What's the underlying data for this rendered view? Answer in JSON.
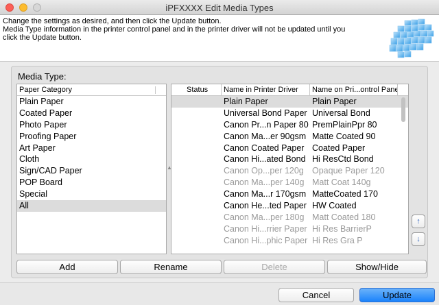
{
  "window": {
    "title": "iPFXXXX Edit Media Types"
  },
  "info": {
    "lines": [
      "Change the settings as desired, and then click the Update button.",
      "Media Type information in the printer control panel and in the printer driver will not be updated until you",
      "click the Update button."
    ],
    "logo_icon": "printer-media-logo-icon"
  },
  "media_type_group": {
    "label": "Media Type:"
  },
  "paper_category": {
    "header": "Paper Category",
    "items": [
      "Plain Paper",
      "Coated Paper",
      "Photo Paper",
      "Proofing Paper",
      "Art Paper",
      "Cloth",
      "Sign/CAD Paper",
      "POP Board",
      "Special",
      "All"
    ],
    "selected": "All"
  },
  "media_table": {
    "headers": [
      "Status",
      "Name in Printer Driver",
      "Name on Pri...ontrol Panel"
    ],
    "rows": [
      {
        "status": "",
        "driver": "Plain Paper",
        "panel": "Plain Paper"
      },
      {
        "status": "",
        "driver": "Universal Bond Paper",
        "panel": "Universal Bond"
      },
      {
        "status": "",
        "driver": "Canon Pr...n Paper 80",
        "panel": "PremPlainPpr 80"
      },
      {
        "status": "",
        "driver": "Canon Ma...er 90gsm",
        "panel": "Matte Coated 90"
      },
      {
        "status": "",
        "driver": "Canon Coated Paper",
        "panel": "Coated Paper"
      },
      {
        "status": "",
        "driver": "Canon Hi...ated Bond",
        "panel": "Hi ResCtd Bond"
      },
      {
        "status": "",
        "driver": "Canon Op...per 120g",
        "panel": "Opaque Paper 120"
      },
      {
        "status": "",
        "driver": "Canon Ma...per 140g",
        "panel": "Matt Coat 140g"
      },
      {
        "status": "",
        "driver": "Canon Ma...r 170gsm",
        "panel": "MatteCoated 170"
      },
      {
        "status": "",
        "driver": "Canon He...ted Paper",
        "panel": "HW Coated"
      },
      {
        "status": "",
        "driver": "Canon Ma...per 180g",
        "panel": "Matt Coated 180"
      },
      {
        "status": "",
        "driver": "Canon Hi...rrier Paper",
        "panel": "Hi Res BarrierP"
      },
      {
        "status": "",
        "driver": "Canon Hi...phic Paper",
        "panel": "Hi Res Gra P"
      }
    ],
    "selected_row": 0,
    "dimmed_rows": [
      6,
      7,
      10,
      11,
      12
    ]
  },
  "side_buttons": {
    "up_icon": "move-up-icon",
    "down_icon": "move-down-icon"
  },
  "buttons": {
    "add": "Add",
    "rename": "Rename",
    "delete": "Delete",
    "show_hide": "Show/Hide",
    "cancel": "Cancel",
    "update": "Update"
  },
  "colors": {
    "accent": "#1a82fb",
    "selection": "#dcdcdc",
    "dimmed_text": "#9a9a9a"
  }
}
